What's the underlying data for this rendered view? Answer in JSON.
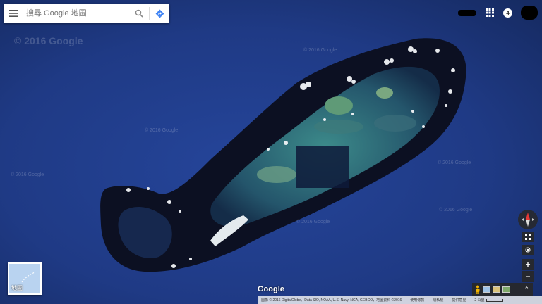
{
  "search": {
    "placeholder": "搜尋 Google 地圖"
  },
  "header": {
    "notification_count": "4"
  },
  "map": {
    "watermark": "© 2016 Google",
    "tile_watermark": "© 2016 Google",
    "type": "satellite",
    "colors": {
      "ocean": "#1f3a85",
      "reef_dark": "#0c1022",
      "lagoon": "#2c6a78",
      "sand": "#dfe6ea"
    }
  },
  "minimap": {
    "label": "地圖"
  },
  "brand": {
    "logo": "Google"
  },
  "footer": {
    "attribution": "圖像 © 2016 DigitalGlobe、Data SIO, NOAA, U.S. Navy, NGA, GEBCO，地圖資料 ©2016",
    "terms": "使用條款",
    "privacy": "隱私權",
    "feedback": "提供意見",
    "scale": "2 公里"
  },
  "controls": {
    "zoom_in": "+",
    "zoom_out": "−",
    "expand": "⌃"
  }
}
